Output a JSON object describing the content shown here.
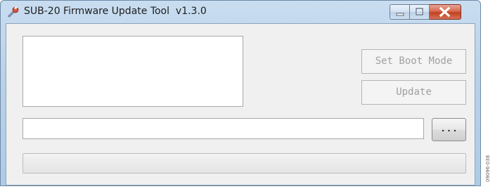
{
  "window": {
    "title": "SUB-20 Firmware Update Tool  v1.3.0",
    "app_icon": "wrench-icon",
    "caption_buttons": [
      "minimize-icon",
      "maximize-icon",
      "close-icon"
    ]
  },
  "log": {
    "lines": []
  },
  "buttons": {
    "set_boot_mode": "Set Boot Mode",
    "update": "Update",
    "browse": "...",
    "set_boot_mode_enabled": false,
    "update_enabled": false
  },
  "file_path": {
    "value": "",
    "placeholder": ""
  },
  "progress": {
    "percent": 0
  },
  "figure_id": "09096-038",
  "colors": {
    "close_button": "#c2421f",
    "disabled_text": "#a0a0a0",
    "window_frame": "#b9d2ea"
  }
}
